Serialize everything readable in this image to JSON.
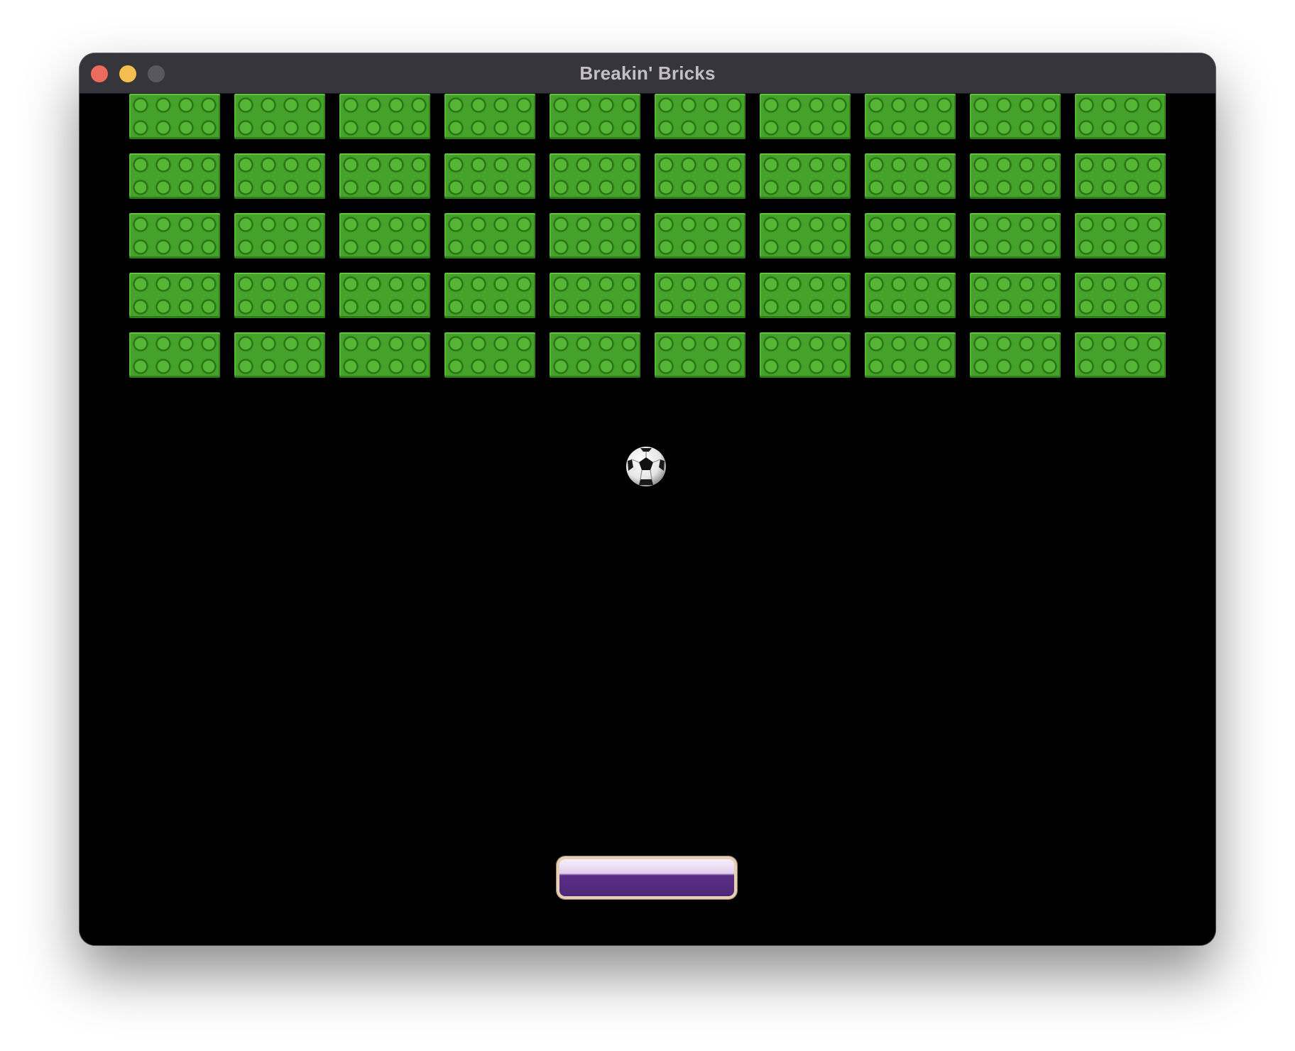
{
  "window": {
    "title": "Breakin' Bricks",
    "controls": {
      "close_color": "#ed6a5e",
      "minimize_color": "#f5bf4f",
      "zoom_color": "#5a585f"
    }
  },
  "game": {
    "background_color": "#000000",
    "bricks": {
      "rows": 5,
      "columns": 10,
      "color": "#45a22a",
      "style": "lego-2x4-studs"
    },
    "ball": {
      "icon": "soccer-ball-icon"
    },
    "paddle": {
      "color": "#4e2877",
      "border_color": "#e5d0b5"
    }
  }
}
